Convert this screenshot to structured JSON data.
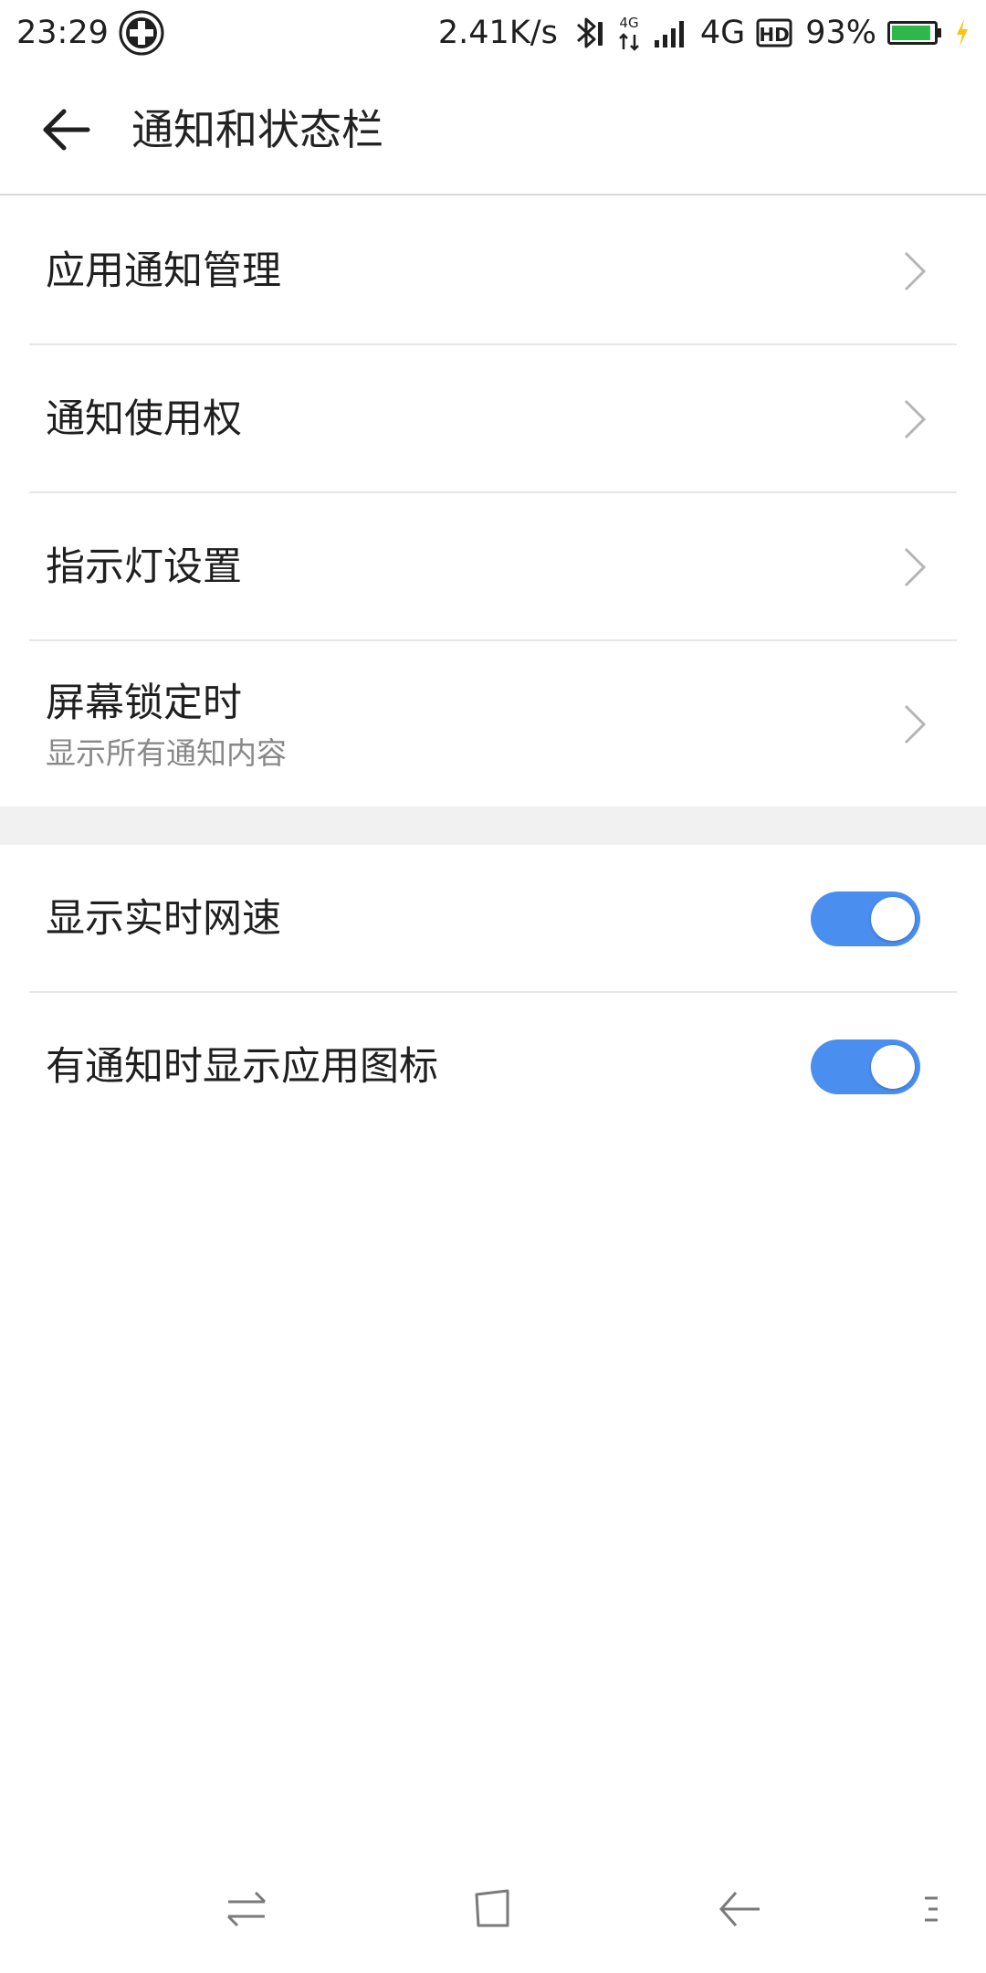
{
  "status_bar": {
    "time": "23:29",
    "net_speed": "2.41K/s",
    "network_label": "4G",
    "small_network_label": "4G",
    "hd_label": "HD",
    "battery_percent": "93%",
    "battery_level": 0.93,
    "battery_color": "#2fb84a",
    "charging_color": "#f5c518"
  },
  "header": {
    "title": "通知和状态栏"
  },
  "nav_items": [
    {
      "title": "应用通知管理"
    },
    {
      "title": "通知使用权"
    },
    {
      "title": "指示灯设置"
    },
    {
      "title": "屏幕锁定时",
      "subtitle": "显示所有通知内容"
    }
  ],
  "toggle_items": [
    {
      "title": "显示实时网速",
      "on": true
    },
    {
      "title": "有通知时显示应用图标",
      "on": true
    }
  ],
  "colors": {
    "accent": "#4a8ef0",
    "divider": "#e6e6e6",
    "section_gap": "#f1f1f1",
    "subtitle": "#888888"
  },
  "icons": {
    "back": "arrow-left-icon",
    "chevron": "chevron-right-icon",
    "nav_recents": "swap-arrows-icon",
    "nav_home": "square-icon",
    "nav_back": "back-arrow-icon",
    "nav_menu": "menu-lines-icon"
  }
}
